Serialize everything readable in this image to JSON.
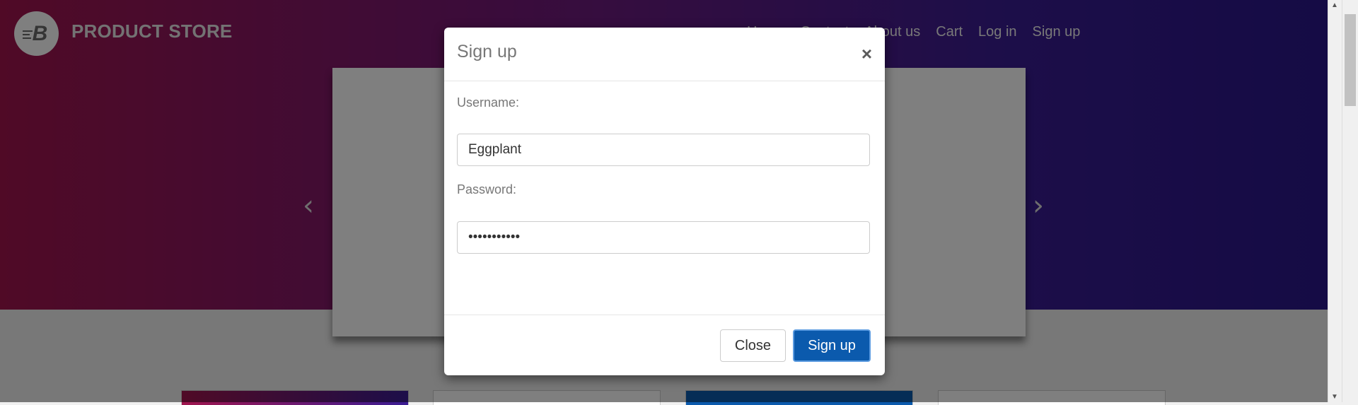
{
  "brand": {
    "title": "PRODUCT STORE",
    "logo_letter": "B"
  },
  "nav": {
    "items": [
      "Home",
      "Contact",
      "About us",
      "Cart",
      "Log in",
      "Sign up"
    ]
  },
  "carousel": {
    "prev": "‹",
    "next": "›"
  },
  "modal": {
    "title": "Sign up",
    "close_symbol": "×",
    "username_label": "Username:",
    "username_value": "Eggplant",
    "password_label": "Password:",
    "password_value": "•••••••••••",
    "close_button": "Close",
    "signup_button": "Sign up"
  },
  "colors": {
    "primary": "#0b5aad",
    "hero_start": "#a0154d",
    "hero_end": "#2a178a"
  }
}
